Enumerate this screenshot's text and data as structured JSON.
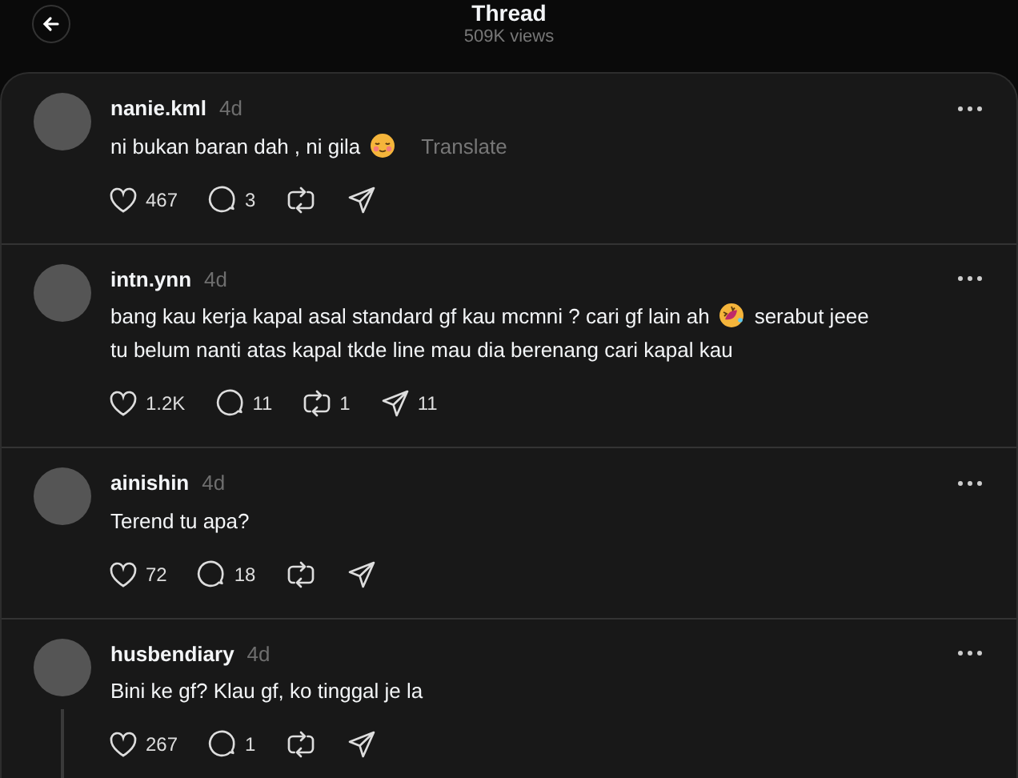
{
  "header": {
    "title": "Thread",
    "subtitle": "509K views"
  },
  "comments": [
    {
      "username": "nanie.kml",
      "time": "4d",
      "lines": [
        [
          {
            "kind": "text",
            "text": "ni bukan baran dah , ni gila"
          },
          {
            "kind": "relieved"
          }
        ]
      ],
      "translate": "Translate",
      "likes": "467",
      "replies": "3",
      "reply_line": false
    },
    {
      "username": "intn.ynn",
      "time": "4d",
      "lines": [
        [
          {
            "kind": "text",
            "text": "bang kau kerja kapal asal standard gf kau mcmni ? cari gf lain ah"
          },
          {
            "kind": "laughing"
          },
          {
            "kind": "text",
            "text": "serabut jeee"
          }
        ],
        [
          {
            "kind": "text",
            "text": "tu belum nanti atas kapal tkde line mau dia berenang cari kapal kau"
          }
        ]
      ],
      "likes": "1.2K",
      "replies": "11",
      "reposts": "1",
      "shares": "11",
      "reply_line": false
    },
    {
      "username": "ainishin",
      "time": "4d",
      "lines": [
        [
          {
            "kind": "text",
            "text": "Terend tu apa?"
          }
        ]
      ],
      "likes": "72",
      "replies": "18",
      "reply_line": false
    },
    {
      "username": "husbendiary",
      "time": "4d",
      "lines": [
        [
          {
            "kind": "text",
            "text": "Bini ke gf? Klau gf, ko tinggal je la"
          }
        ]
      ],
      "likes": "267",
      "replies": "1",
      "reply_line": true
    }
  ]
}
